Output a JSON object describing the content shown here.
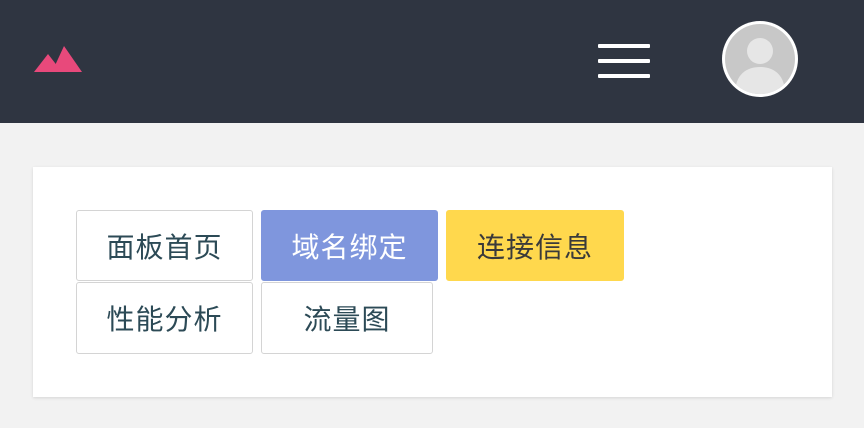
{
  "header": {
    "logo_icon": "mountain-logo-icon",
    "logo_color": "#e8497b",
    "background_color": "#2f3541",
    "menu_icon": "hamburger-menu-icon",
    "avatar_icon": "user-avatar-icon"
  },
  "nav": {
    "buttons": [
      {
        "label": "面板首页",
        "style": "default"
      },
      {
        "label": "域名绑定",
        "style": "primary",
        "color": "#7f96dd"
      },
      {
        "label": "连接信息",
        "style": "warning",
        "color": "#ffd84d"
      },
      {
        "label": "性能分析",
        "style": "default"
      },
      {
        "label": "流量图",
        "style": "default"
      }
    ]
  }
}
